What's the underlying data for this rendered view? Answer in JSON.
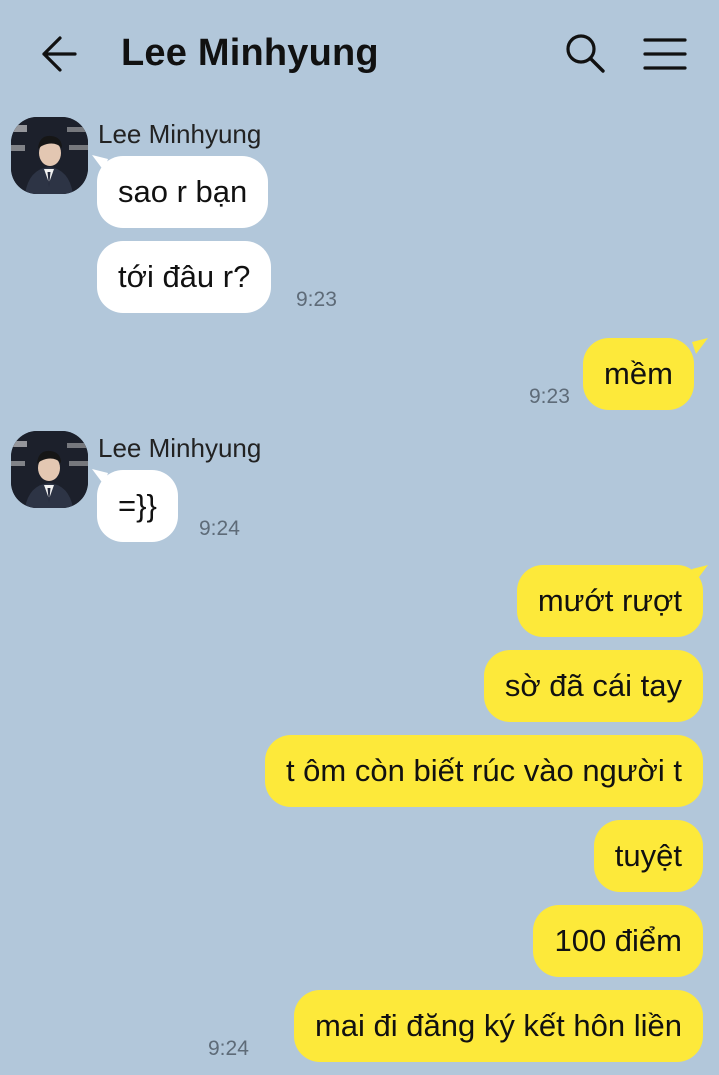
{
  "header": {
    "title": "Lee Minhyung"
  },
  "icons": {
    "back": "back-arrow-icon",
    "search": "search-icon",
    "menu": "hamburger-menu-icon"
  },
  "colors": {
    "background": "#b2c7da",
    "incoming_bubble": "#ffffff",
    "outgoing_bubble": "#fde93a"
  },
  "messages": {
    "group1": {
      "sender": "Lee Minhyung",
      "m1": "sao r bạn",
      "m2": "tới đâu r?",
      "time": "9:23"
    },
    "out1": {
      "m1": "mềm",
      "time": "9:23"
    },
    "group2": {
      "sender": "Lee Minhyung",
      "m1": "=}}",
      "time": "9:24"
    },
    "out2": {
      "m1": "mướt rượt",
      "m2": "sờ đã cái tay",
      "m3": "t ôm còn biết rúc vào người t",
      "m4": "tuyệt",
      "m5": "100 điểm",
      "m6": "mai đi đăng ký kết hôn liền",
      "time": "9:24"
    }
  }
}
